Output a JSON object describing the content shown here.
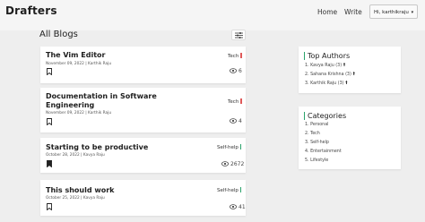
{
  "brand": "Drafters",
  "nav": {
    "home": "Home",
    "write": "Write",
    "user": "Hi, karthikraju"
  },
  "blogs": {
    "heading": "All Blogs",
    "posts": [
      {
        "title": "The Vim Editor",
        "meta": "November 09, 2022 | Karthik Raju",
        "tag": "Tech",
        "tag_color": "#e05a5a",
        "views": "6",
        "bookmarked": false
      },
      {
        "title": "Documentation in Software Engineering",
        "meta": "November 09, 2022 | Karthik Raju",
        "tag": "Tech",
        "tag_color": "#e05a5a",
        "views": "4",
        "bookmarked": false
      },
      {
        "title": "Starting to be productive",
        "meta": "October 28, 2022 | Kavya Raju",
        "tag": "Self-help",
        "tag_color": "#2aa36b",
        "views": "2672",
        "bookmarked": true
      },
      {
        "title": "This should work",
        "meta": "October 25, 2022 | Kavya Raju",
        "tag": "Self-help",
        "tag_color": "#2aa36b",
        "views": "41",
        "bookmarked": false
      }
    ]
  },
  "top_authors": {
    "title": "Top Authors",
    "items": [
      "1. Kavya Raju (3)",
      "2. Sahana Krishna (3)",
      "3. Karthik Raju (3)"
    ]
  },
  "categories": {
    "title": "Categories",
    "items": [
      "1. Personal",
      "2. Tech",
      "3. Self-help",
      "4. Entertainment",
      "5. Lifestyle"
    ]
  },
  "colors": {
    "accent": "#2aa36b",
    "tech": "#e05a5a",
    "background": "#eeeeee"
  },
  "icons": {
    "filter": "sliders-icon",
    "bookmark": "bookmark-icon",
    "views": "eye-icon",
    "author_arrow": "arrow-up-icon"
  }
}
